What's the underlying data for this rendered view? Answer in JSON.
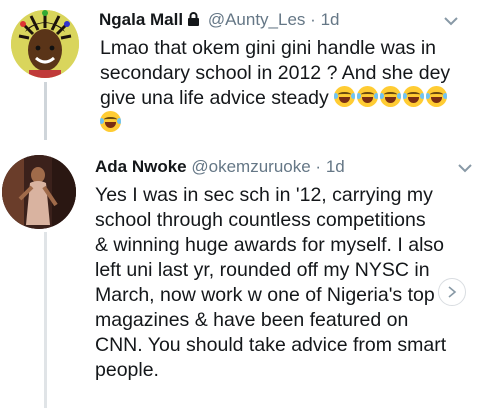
{
  "tweets": [
    {
      "name": "Ngala Mall",
      "handle": "@Aunty_Les",
      "separator": "·",
      "time": "1d",
      "lines": [
        "Lmao that okem gini gini handle was in",
        "secondary school in 2012 ? And she dey",
        "give una life advice steady"
      ],
      "emoji_count_line3": 5,
      "emoji_count_line4": 1,
      "emoji_name": "face-with-tears-of-joy",
      "locked": true
    },
    {
      "name": "Ada Nwoke",
      "handle": "@okemzuruoke",
      "separator": "·",
      "time": "1d",
      "lines": [
        "Yes I was in sec sch in '12, carrying my",
        "school through countless competitions",
        "& winning huge awards for myself. I also",
        "left uni last yr, rounded off my NYSC in",
        "March, now work w one of Nigeria's top",
        "magazines & have been featured on",
        "CNN. You should take advice from smart",
        "people."
      ]
    }
  ],
  "colors": {
    "text": "#14171a",
    "muted": "#657786",
    "thread": "#cfd5da"
  },
  "icons": {
    "lock": "lock-icon",
    "chevron": "chevron-down-icon",
    "scroll": "chevron-right-icon"
  }
}
